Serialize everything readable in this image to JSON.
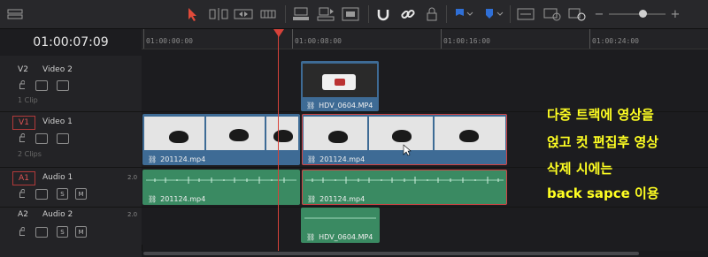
{
  "toolbar": {
    "icons": [
      "timeline-layout-icon",
      "selection-arrow-icon",
      "trim-icon",
      "dynamic-trim-icon",
      "blade-icon",
      "insert-icon",
      "overwrite-icon",
      "replace-icon",
      "snapping-icon",
      "linked-selection-icon",
      "position-lock-icon",
      "flag-icon",
      "marker-icon",
      "zoom-fit-icon",
      "zoom-detail-icon",
      "zoom-custom-icon"
    ],
    "accent": "#2f6fd6",
    "arrow_color": "#e04a3a",
    "zoom_minus": "−",
    "zoom_plus": "+"
  },
  "timecode": "01:00:07:09",
  "ruler": {
    "labels": [
      "01:00:00:00",
      "01:00:08:00",
      "01:00:16:00",
      "01:00:24:00"
    ]
  },
  "tracks": [
    {
      "id": "V2",
      "name": "Video 2",
      "count": "1 Clip",
      "type": "video",
      "selected": false
    },
    {
      "id": "V1",
      "name": "Video 1",
      "count": "2 Clips",
      "type": "video",
      "selected": true
    },
    {
      "id": "A1",
      "name": "Audio 1",
      "gain": "2.0",
      "type": "audio",
      "selected": true,
      "solo": "S",
      "mute": "M"
    },
    {
      "id": "A2",
      "name": "Audio 2",
      "gain": "2.0",
      "type": "audio",
      "selected": false,
      "solo": "S",
      "mute": "M"
    }
  ],
  "clips": {
    "v2": "HDV_0604.MP4",
    "v1_left": "201124.mp4",
    "v1_right": "201124.mp4",
    "a1_left": "201124.mp4",
    "a1_right": "201124.mp4",
    "a2": "HDV_0604.MP4"
  },
  "annotation": {
    "lines": [
      "다중 트랙에 영상을",
      "얹고 컷 편집후 영상",
      "삭제 시에는",
      "back sapce 이용"
    ],
    "color": "#ffff22"
  },
  "colors": {
    "video_clip": "#3e6b95",
    "audio_clip": "#3a8a62",
    "playhead": "#d6423a",
    "selection": "#d04444"
  }
}
